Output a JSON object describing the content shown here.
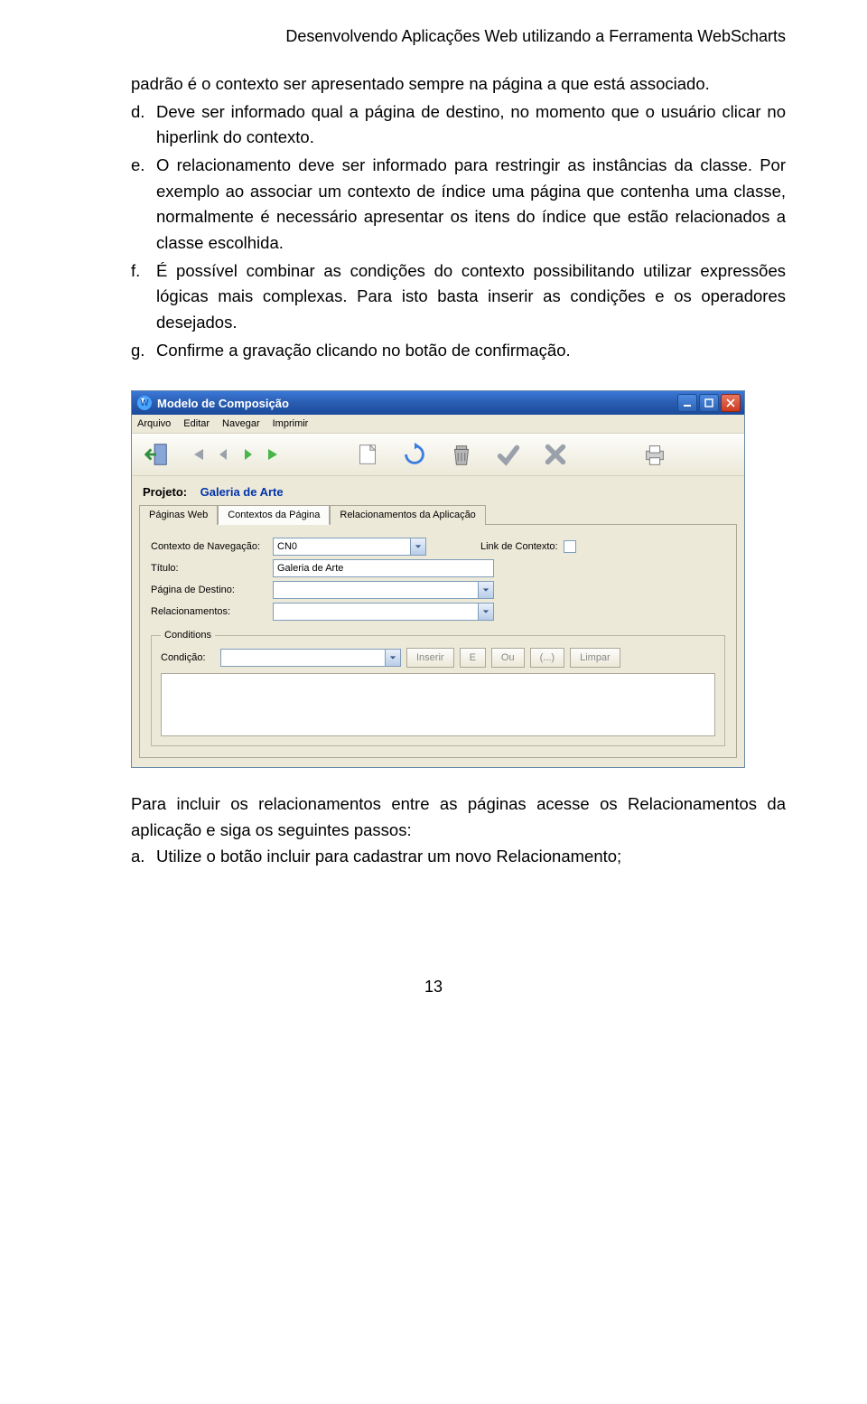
{
  "header": {
    "title": "Desenvolvendo Aplicações Web utilizando a Ferramenta WebScharts"
  },
  "para1_cont": "padrão é o contexto ser apresentado sempre na página a que está associado.",
  "items": {
    "d": {
      "marker": "d.",
      "text": "Deve ser informado qual a página de destino, no momento que o usuário clicar no hiperlink do contexto."
    },
    "e": {
      "marker": "e.",
      "text": "O relacionamento deve ser informado para restringir as instâncias da classe. Por exemplo ao associar um contexto de índice uma página que contenha uma classe, normalmente é necessário apresentar os itens do índice que estão relacionados a classe escolhida."
    },
    "f": {
      "marker": "f.",
      "text": "É possível combinar as condições do contexto possibilitando utilizar expressões lógicas mais complexas. Para isto basta inserir as condições e os operadores desejados."
    },
    "g": {
      "marker": "g.",
      "text": "Confirme a gravação clicando no botão de confirmação."
    }
  },
  "window": {
    "title": "Modelo de Composição",
    "menu": {
      "arquivo": "Arquivo",
      "editar": "Editar",
      "navegar": "Navegar",
      "imprimir": "Imprimir"
    },
    "projeto_label": "Projeto:",
    "projeto_value": "Galeria de Arte",
    "tabs": {
      "t1": "Páginas Web",
      "t2": "Contextos da Página",
      "t3": "Relacionamentos da Aplicação"
    },
    "form": {
      "contexto_label": "Contexto de Navegação:",
      "contexto_value": "CN0",
      "link_label": "Link de Contexto:",
      "titulo_label": "Título:",
      "titulo_value": "Galeria de Arte",
      "pagina_label": "Página de Destino:",
      "relac_label": "Relacionamentos:"
    },
    "conditions": {
      "legend": "Conditions",
      "condicao_label": "Condição:",
      "btn_inserir": "Inserir",
      "btn_e": "E",
      "btn_ou": "Ou",
      "btn_paren": "(...)",
      "btn_limpar": "Limpar"
    }
  },
  "after": {
    "line1": "Para incluir os relacionamentos entre as páginas acesse os Relacionamentos da aplicação e siga os seguintes passos:",
    "a": {
      "marker": "a.",
      "text": "Utilize o botão incluir para cadastrar um novo Relacionamento;"
    }
  },
  "page_number": "13"
}
